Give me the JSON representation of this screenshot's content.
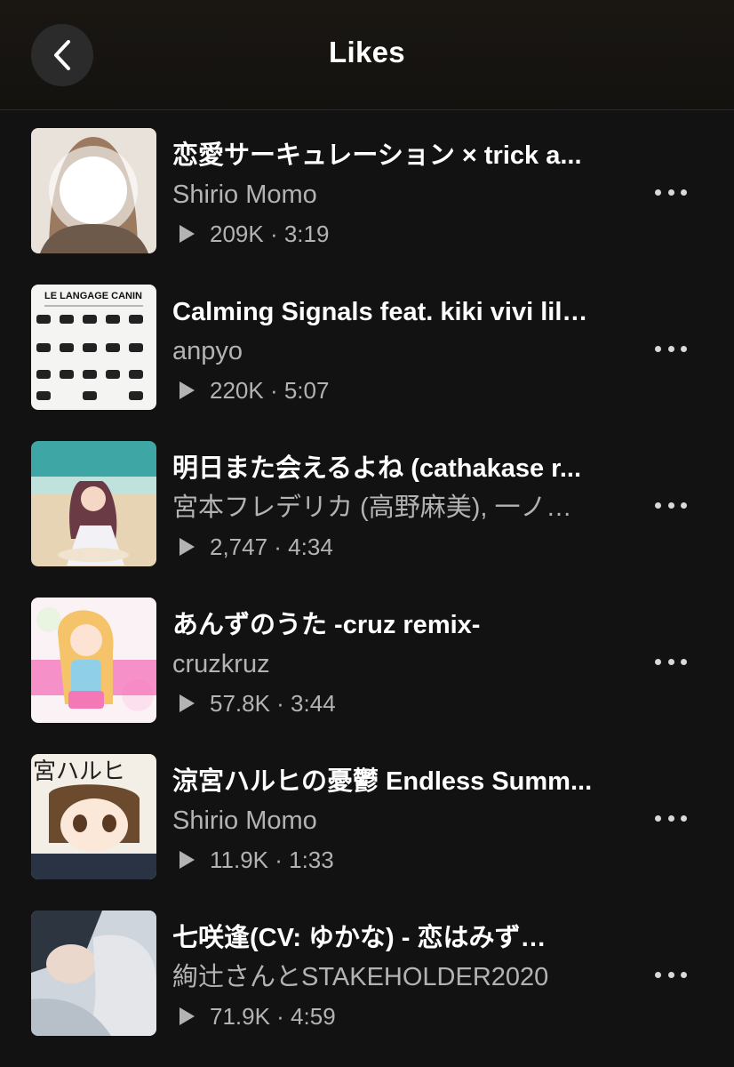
{
  "header": {
    "title": "Likes"
  },
  "tracks": [
    {
      "title": "恋愛サーキュレーション × trick a...",
      "artist": "Shirio Momo",
      "stats": "209K · 3:19"
    },
    {
      "title": "Calming Signals feat. kiki vivi lil…",
      "artist": "anpyo",
      "stats": "220K · 5:07",
      "art_text": "LE LANGAGE CANIN"
    },
    {
      "title": "明日また会えるよね (cathakase r...",
      "artist": "宮本フレデリカ (高野麻美), 一ノ…",
      "stats": "2,747 · 4:34"
    },
    {
      "title": "あんずのうた -cruz remix-",
      "artist": "cruzkruz",
      "stats": "57.8K · 3:44"
    },
    {
      "title": "涼宮ハルヒの憂鬱 Endless Summ...",
      "artist": "Shirio Momo",
      "stats": "11.9K · 1:33",
      "art_text": "宮ハルヒ"
    },
    {
      "title": "七咲逢(CV: ゆかな) - 恋はみず…",
      "artist": "絢辻さんとSTAKEHOLDER2020",
      "stats": "71.9K · 4:59"
    }
  ]
}
